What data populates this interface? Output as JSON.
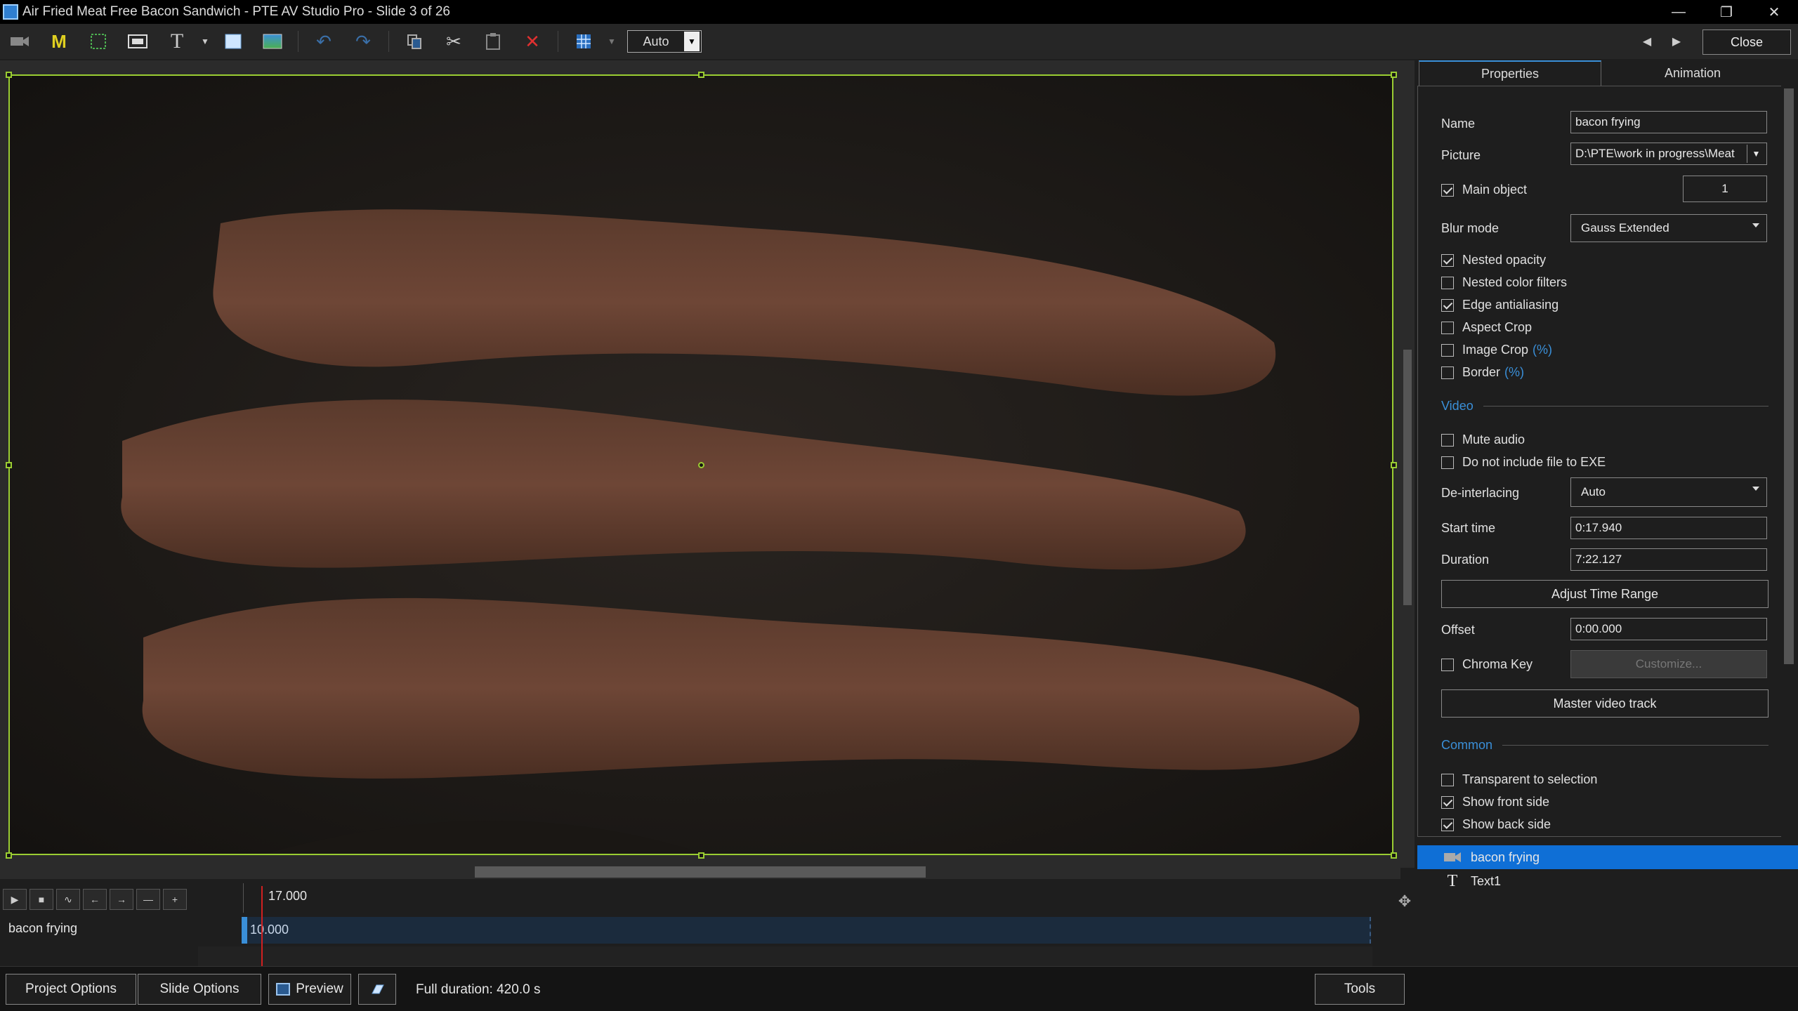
{
  "window": {
    "title": "Air Fried Meat Free Bacon Sandwich - PTE AV Studio Pro - Slide 3 of 26",
    "controls": [
      "minimize",
      "restore",
      "close"
    ]
  },
  "toolbar": {
    "zoom_value": "Auto",
    "close_label": "Close",
    "icons": [
      "video-icon",
      "mask-icon",
      "frame-icon",
      "image-icon",
      "text-icon",
      "rectangle-icon",
      "gradient-icon",
      "undo-icon",
      "redo-icon",
      "copy-icon",
      "cut-icon",
      "paste-icon",
      "delete-icon",
      "grid-icon"
    ]
  },
  "tabs": [
    {
      "label": "Properties",
      "active": true
    },
    {
      "label": "Animation",
      "active": false
    }
  ],
  "properties": {
    "name_label": "Name",
    "name_value": "bacon frying",
    "picture_label": "Picture",
    "picture_value": "D:\\PTE\\work in progress\\Meat",
    "main_object_label": "Main object",
    "main_object_checked": true,
    "main_object_value": "1",
    "blur_label": "Blur mode",
    "blur_value": "Gauss Extended",
    "checks1": [
      {
        "label": "Nested opacity",
        "checked": true,
        "suffix": ""
      },
      {
        "label": "Nested color filters",
        "checked": false,
        "suffix": ""
      },
      {
        "label": "Edge antialiasing",
        "checked": true,
        "suffix": ""
      },
      {
        "label": "Aspect Crop",
        "checked": false,
        "suffix": ""
      },
      {
        "label": "Image Crop",
        "checked": false,
        "suffix": "(%)"
      },
      {
        "label": "Border",
        "checked": false,
        "suffix": "(%)"
      }
    ],
    "video_section": "Video",
    "checks2": [
      {
        "label": "Mute audio",
        "checked": false
      },
      {
        "label": "Do not include file to EXE",
        "checked": false
      }
    ],
    "deinterlace_label": "De-interlacing",
    "deinterlace_value": "Auto",
    "start_label": "Start time",
    "start_value": "0:17.940",
    "duration_label": "Duration",
    "duration_value": "7:22.127",
    "adjust_button": "Adjust Time Range",
    "offset_label": "Offset",
    "offset_value": "0:00.000",
    "chroma_label": "Chroma Key",
    "chroma_checked": false,
    "customize_button": "Customize...",
    "master_button": "Master video track",
    "common_section": "Common",
    "checks3": [
      {
        "label": "Transparent to selection",
        "checked": false
      },
      {
        "label": "Show front side",
        "checked": true
      },
      {
        "label": "Show back side",
        "checked": true
      }
    ]
  },
  "objects": [
    {
      "label": "bacon frying",
      "icon": "video-icon",
      "selected": true
    },
    {
      "label": "Text1",
      "icon": "text-icon",
      "selected": false
    }
  ],
  "timeline": {
    "time": "17.000",
    "track_label": "bacon frying",
    "track_value": "10.000"
  },
  "bottom": {
    "project_options": "Project Options",
    "slide_options": "Slide Options",
    "preview": "Preview",
    "full_duration": "Full duration: 420.0 s",
    "tools": "Tools"
  },
  "colors": {
    "accent": "#3a8fd8",
    "selection": "#9acd32",
    "playhead": "#d02020"
  }
}
